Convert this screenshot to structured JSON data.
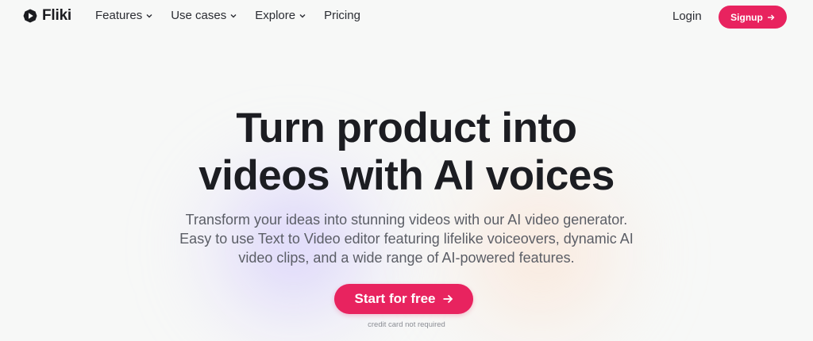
{
  "brand": {
    "name": "Fliki"
  },
  "nav": {
    "items": [
      {
        "label": "Features",
        "dropdown": true
      },
      {
        "label": "Use cases",
        "dropdown": true
      },
      {
        "label": "Explore",
        "dropdown": true
      },
      {
        "label": "Pricing",
        "dropdown": false
      }
    ],
    "login_label": "Login",
    "signup_label": "Signup"
  },
  "hero": {
    "headline_lines": [
      "Turn product into",
      "videos with AI voices"
    ],
    "subtitle_lines": [
      "Transform your ideas into stunning videos with our AI video generator.",
      "Easy to use Text to Video editor featuring lifelike voiceovers, dynamic AI",
      "video clips, and a wide range of AI-powered features."
    ],
    "cta_label": "Start for free",
    "note": "credit card not required"
  },
  "colors": {
    "accent": "#e8235f",
    "background": "#f7f8f7",
    "text": "#1c1d22",
    "muted": "#5b5e66"
  },
  "icons": {
    "logo": "fliki-play-logo-icon",
    "dropdown": "chevron-down-icon",
    "arrow": "arrow-right-icon"
  }
}
